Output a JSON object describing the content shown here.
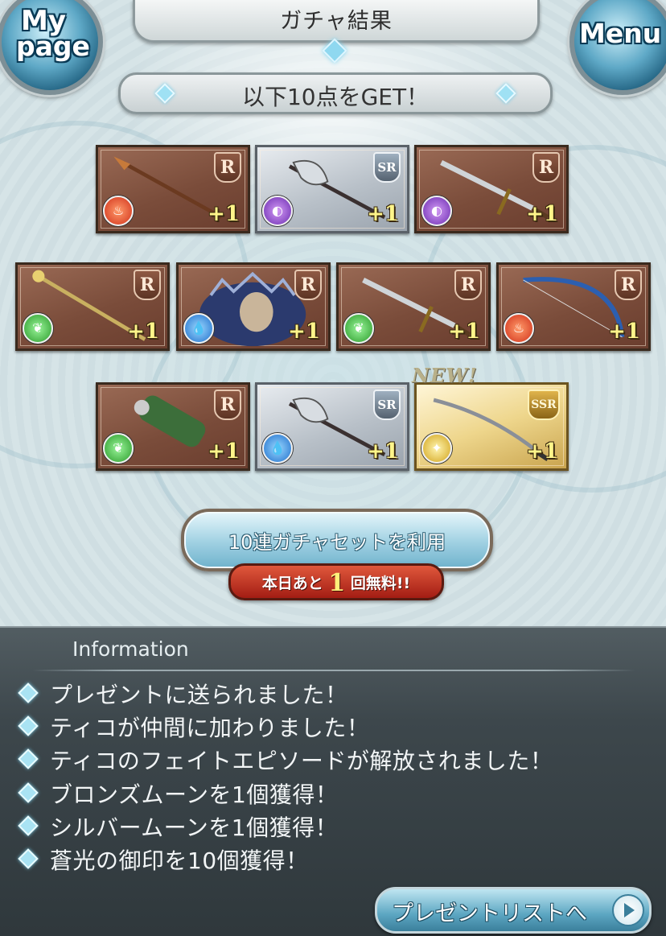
{
  "header": {
    "title": "ガチャ結果",
    "mypage_line1": "My",
    "mypage_line2": "page",
    "menu_label": "Menu"
  },
  "result": {
    "banner_text": "以下10点をGET！"
  },
  "cards": [
    {
      "rarity": "R",
      "element": "fire",
      "count": "+1",
      "item": "spear-weapon"
    },
    {
      "rarity": "SR",
      "element": "dark",
      "count": "+1",
      "item": "axe-weapon"
    },
    {
      "rarity": "R",
      "element": "dark",
      "count": "+1",
      "item": "sword-weapon"
    },
    {
      "rarity": "R",
      "element": "wind",
      "count": "+1",
      "item": "staff-weapon"
    },
    {
      "rarity": "R",
      "element": "water",
      "count": "+1",
      "item": "summon-creature"
    },
    {
      "rarity": "R",
      "element": "wind",
      "count": "+1",
      "item": "sword-weapon"
    },
    {
      "rarity": "R",
      "element": "fire",
      "count": "+1",
      "item": "bow-weapon"
    },
    {
      "rarity": "R",
      "element": "wind",
      "count": "+1",
      "item": "gauntlet-weapon"
    },
    {
      "rarity": "SR",
      "element": "water",
      "count": "+1",
      "item": "axe-weapon"
    },
    {
      "rarity": "SSR",
      "element": "light",
      "count": "+1",
      "item": "katana-weapon"
    }
  ],
  "new_tag": "NEW!",
  "gacha_button": {
    "label": "10連ガチャセットを利用",
    "free_prefix": "本日あと",
    "free_count": "1",
    "free_suffix": "回無料!!"
  },
  "information": {
    "title": "Information",
    "items": [
      "プレゼントに送られました！",
      "ティコが仲間に加わりました！",
      "ティコのフェイトエピソードが解放されました！",
      "ブロンズムーンを1個獲得！",
      "シルバームーンを1個獲得！",
      "蒼光の御印を10個獲得！"
    ]
  },
  "present_button": {
    "label": "プレゼントリストへ"
  },
  "colors": {
    "accent": "#6fb2cc",
    "panel": "#3d474c",
    "r_card": "#7a4c3a",
    "ssr_card": "#eed68c"
  }
}
